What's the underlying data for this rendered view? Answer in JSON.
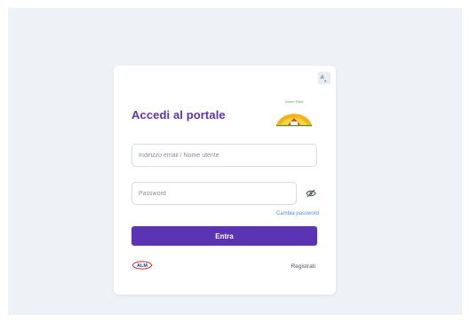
{
  "login": {
    "title": "Accedi al portale",
    "logo_text": "Green Field",
    "email_placeholder": "Indirizzo email / Nome utente",
    "email_value": "",
    "password_placeholder": "Password",
    "password_value": "",
    "change_password_label": "Cambia password",
    "submit_label": "Entra",
    "register_label": "Registrati",
    "partner_logo_text": "ALM"
  },
  "icons": {
    "translate": "translate-icon",
    "toggle_password": "eye-off-icon"
  },
  "colors": {
    "page_background": "#eef1f6",
    "card": "#ffffff",
    "accent": "#5a34b2",
    "title": "#5c34b0",
    "link": "#4c8ce6"
  }
}
